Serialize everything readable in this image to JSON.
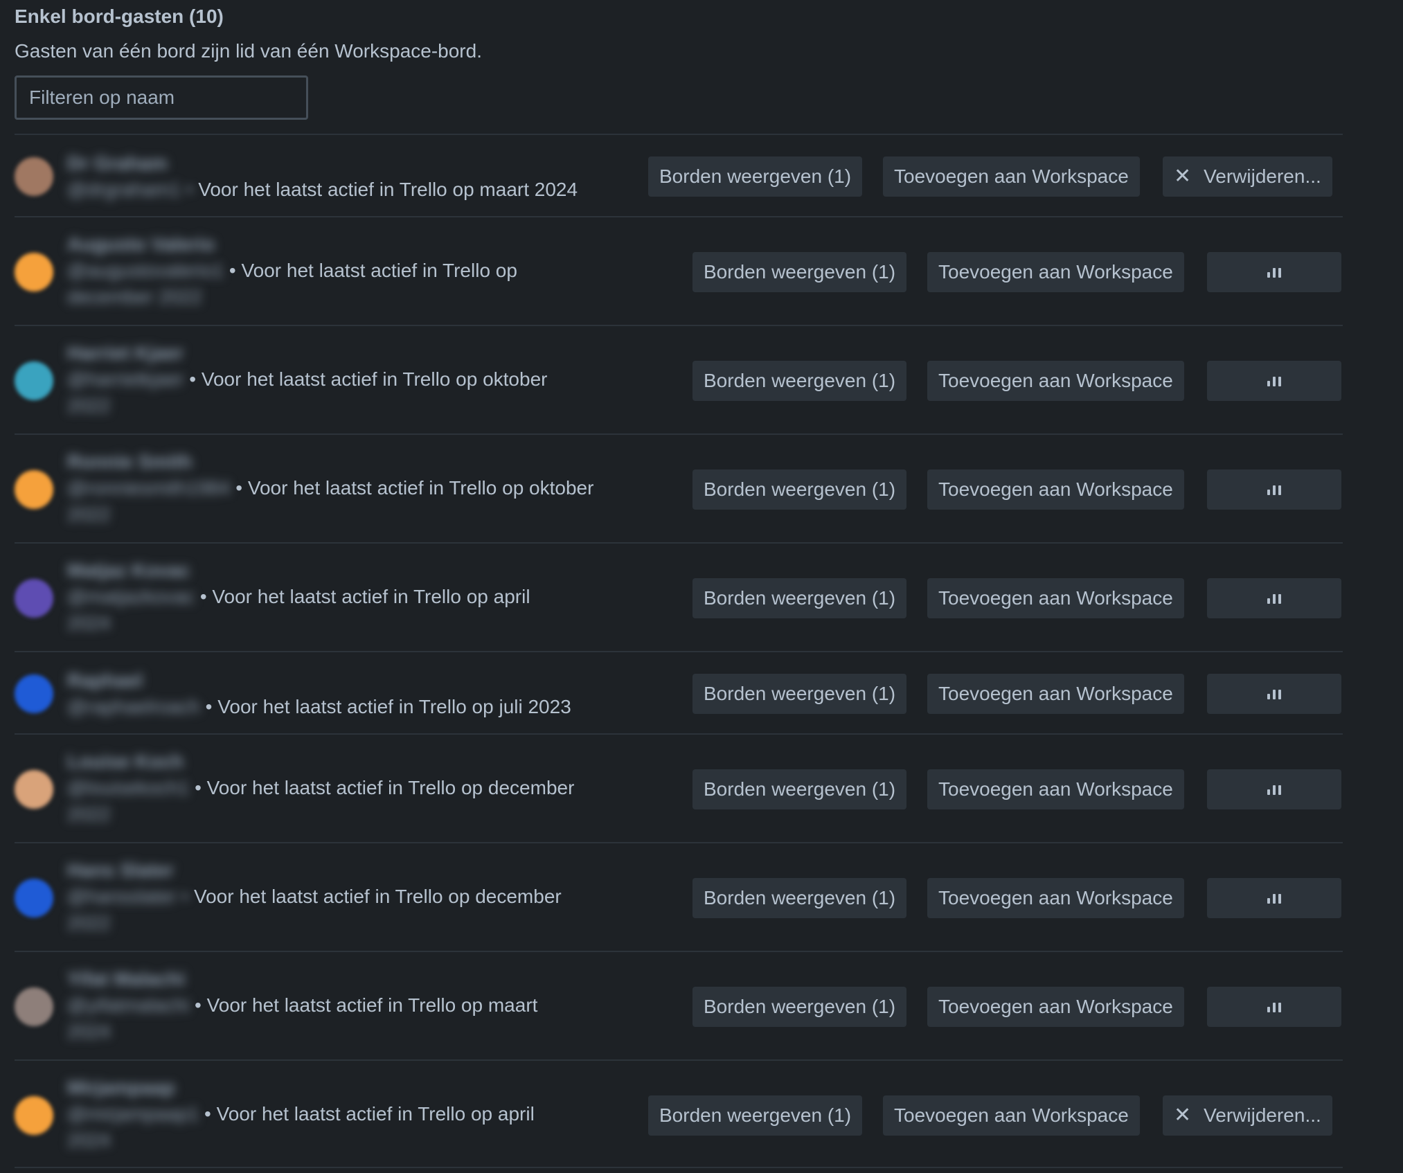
{
  "section": {
    "title": "Enkel bord-gasten (10)",
    "description": "Gasten van één bord zijn lid van één Workspace-bord.",
    "filter_placeholder": "Filteren op naam"
  },
  "buttons": {
    "view_boards": "Borden weergeven (1)",
    "add_to_workspace": "Toevoegen aan Workspace",
    "remove": "Verwijderen...",
    "remove_icon": "close-icon",
    "loading_icon": "spinner-icon"
  },
  "members": [
    {
      "name": "Dr Graham",
      "username": "@drgraham1 •",
      "line1": " Voor het laatst actief in Trello op maart 2024",
      "line2": "",
      "avatar_color": "#a07862",
      "state": "remove"
    },
    {
      "name": "Augusto Valerio",
      "username": "@augustovalerio1",
      "line1": " • Voor het laatst actief in Trello op",
      "line2": "december 2022",
      "avatar_color": "#f5a13c",
      "state": "loading"
    },
    {
      "name": "Harriet Kjaer",
      "username": "@harrietkjaer",
      "line1": " • Voor het laatst actief in Trello op oktober",
      "line2": "2022",
      "avatar_color": "#3aa3bf",
      "state": "loading"
    },
    {
      "name": "Ronnie Smith",
      "username": "@ronniesmith1984",
      "line1": " • Voor het laatst actief in Trello op oktober",
      "line2": "2022",
      "avatar_color": "#f5a13c",
      "state": "loading"
    },
    {
      "name": "Matjaz Kovac",
      "username": "@matjazkovac",
      "line1": " • Voor het laatst actief in Trello op april",
      "line2": "2024",
      "avatar_color": "#5e4db2",
      "state": "loading"
    },
    {
      "name": "Raphael",
      "username": "@raphaelroach",
      "line1": " • Voor het laatst actief in Trello op juli 2023",
      "line2": "",
      "avatar_color": "#1f5bd6",
      "state": "loading"
    },
    {
      "name": "Louise Koch",
      "username": "@louisekoch1",
      "line1": " • Voor het laatst actief in Trello op december",
      "line2": "2022",
      "avatar_color": "#d9a37a",
      "state": "loading"
    },
    {
      "name": "Hans Slater",
      "username": "@hansslater •",
      "line1": " Voor het laatst actief in Trello op december",
      "line2": "2022",
      "avatar_color": "#1f5bd6",
      "state": "loading"
    },
    {
      "name": "Yifat Malachi",
      "username": "@yifatmalachi",
      "line1": " • Voor het laatst actief in Trello op maart",
      "line2": "2024",
      "avatar_color": "#8e7f7a",
      "state": "loading"
    },
    {
      "name": "Mirjampaap",
      "username": "@mirjampaap1",
      "line1": " • Voor het laatst actief in Trello op april",
      "line2": "2024",
      "avatar_color": "#f5a13c",
      "state": "remove"
    }
  ]
}
